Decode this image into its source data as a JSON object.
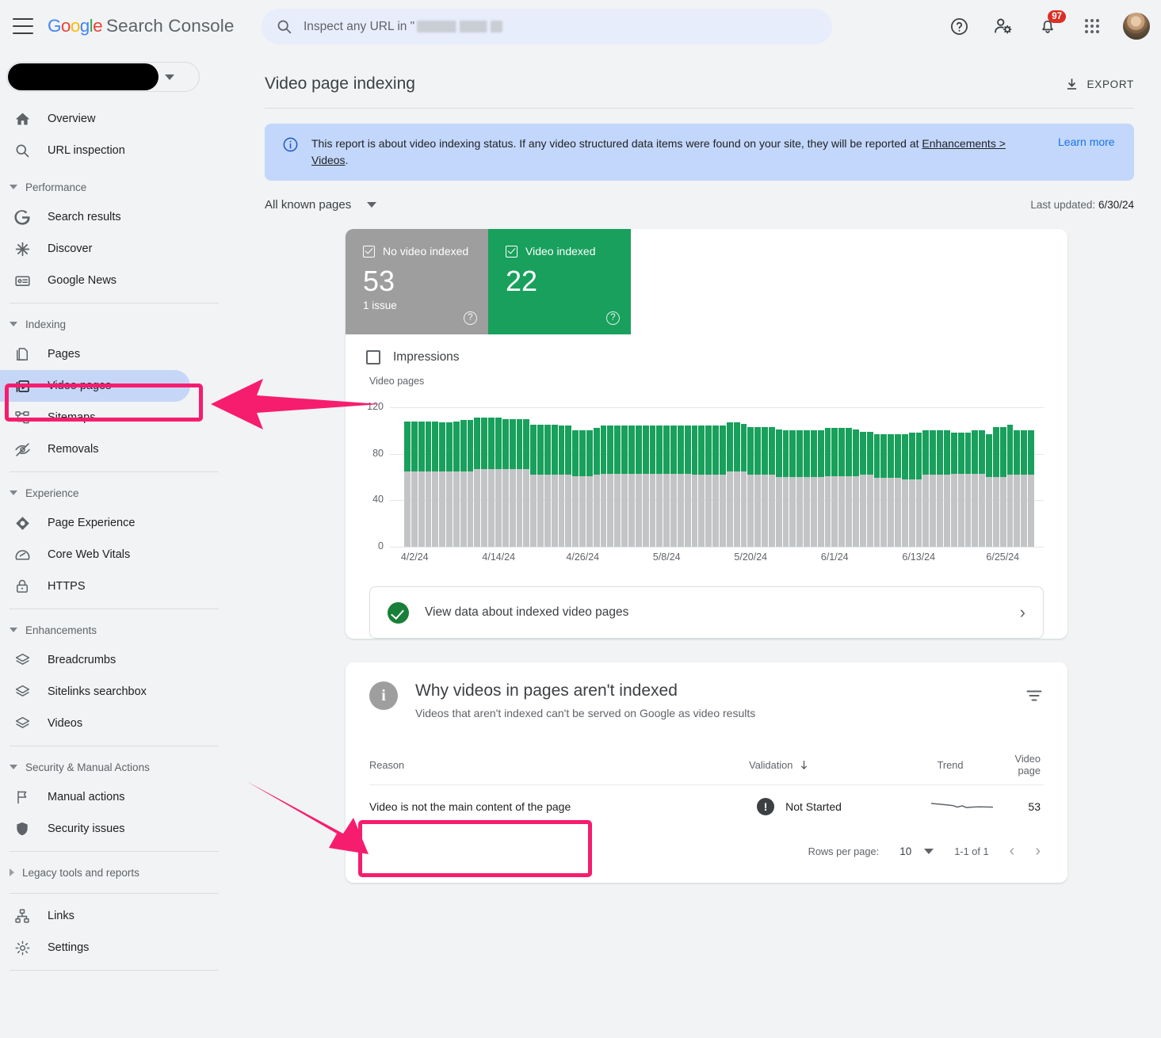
{
  "header": {
    "brand_google": "Google",
    "brand_suffix": "Search Console",
    "search_placeholder_prefix": "Inspect any URL in \"",
    "notification_count": "97",
    "icons": {
      "menu": "hamburger-icon",
      "search": "search-icon",
      "help": "help-icon",
      "users": "user-settings-icon",
      "notifications": "bell-icon",
      "apps": "apps-grid-icon",
      "avatar": "avatar"
    }
  },
  "sidebar": {
    "property_selector_label": "",
    "groups": [
      {
        "type": "items",
        "items": [
          {
            "label": "Overview",
            "icon": "home-icon"
          },
          {
            "label": "URL inspection",
            "icon": "search-icon"
          }
        ]
      },
      {
        "type": "section",
        "title": "Performance",
        "expanded": true,
        "items": [
          {
            "label": "Search results",
            "icon": "google-g-icon"
          },
          {
            "label": "Discover",
            "icon": "discover-icon"
          },
          {
            "label": "Google News",
            "icon": "news-icon"
          }
        ]
      },
      {
        "type": "section",
        "title": "Indexing",
        "expanded": true,
        "items": [
          {
            "label": "Pages",
            "icon": "pages-icon"
          },
          {
            "label": "Video pages",
            "icon": "video-pages-icon",
            "active": true
          },
          {
            "label": "Sitemaps",
            "icon": "sitemaps-icon"
          },
          {
            "label": "Removals",
            "icon": "removals-icon"
          }
        ]
      },
      {
        "type": "section",
        "title": "Experience",
        "expanded": true,
        "items": [
          {
            "label": "Page Experience",
            "icon": "page-experience-icon"
          },
          {
            "label": "Core Web Vitals",
            "icon": "core-web-vitals-icon"
          },
          {
            "label": "HTTPS",
            "icon": "lock-icon"
          }
        ]
      },
      {
        "type": "section",
        "title": "Enhancements",
        "expanded": true,
        "items": [
          {
            "label": "Breadcrumbs",
            "icon": "layers-icon"
          },
          {
            "label": "Sitelinks searchbox",
            "icon": "layers-icon"
          },
          {
            "label": "Videos",
            "icon": "layers-icon"
          }
        ]
      },
      {
        "type": "section",
        "title": "Security & Manual Actions",
        "expanded": true,
        "items": [
          {
            "label": "Manual actions",
            "icon": "flag-icon"
          },
          {
            "label": "Security issues",
            "icon": "shield-icon"
          }
        ]
      },
      {
        "type": "section",
        "title": "Legacy tools and reports",
        "expanded": false,
        "items": []
      },
      {
        "type": "items",
        "items": [
          {
            "label": "Links",
            "icon": "links-icon"
          },
          {
            "label": "Settings",
            "icon": "gear-icon"
          }
        ]
      }
    ]
  },
  "page": {
    "title": "Video page indexing",
    "export_label": "EXPORT",
    "notice": {
      "text_part1": "This report is about video indexing status. If any video structured data items were found on your site, they will be reported at ",
      "link_text": "Enhancements > Videos",
      "text_part2": ".",
      "learn_more": "Learn more"
    },
    "filter_label": "All known pages",
    "last_updated_label": "Last updated: ",
    "last_updated_value": "6/30/24"
  },
  "metrics": [
    {
      "name": "No video indexed",
      "value": "53",
      "sub": "1 issue",
      "color": "#9e9e9e",
      "help": "?"
    },
    {
      "name": "Video indexed",
      "value": "22",
      "sub": "",
      "color": "#18a05c",
      "help": "?"
    }
  ],
  "impressions_label": "Impressions",
  "view_data_row": {
    "label": "View data about indexed video pages"
  },
  "chart_data": {
    "type": "bar",
    "title": "",
    "ylabel": "Video pages",
    "xlabel": "",
    "ylim": [
      0,
      120
    ],
    "yticks": [
      0,
      40,
      80,
      120
    ],
    "grid": true,
    "stacked": true,
    "legend": [
      "No video indexed",
      "Video indexed"
    ],
    "legend_position": "top",
    "xtick_labels": [
      "4/2/24",
      "4/14/24",
      "4/26/24",
      "5/8/24",
      "5/20/24",
      "6/1/24",
      "6/13/24",
      "6/25/24"
    ],
    "xtick_indices": [
      1,
      13,
      25,
      37,
      49,
      61,
      73,
      85
    ],
    "series": [
      {
        "name": "No video indexed",
        "color": "#c3c4c6",
        "values": [
          65,
          65,
          65,
          65,
          65,
          65,
          65,
          65,
          65,
          65,
          67,
          67,
          67,
          67,
          67,
          67,
          67,
          67,
          62,
          62,
          62,
          62,
          62,
          62,
          61,
          61,
          61,
          62,
          63,
          63,
          63,
          63,
          63,
          63,
          63,
          63,
          63,
          63,
          63,
          63,
          63,
          62,
          62,
          62,
          62,
          62,
          65,
          65,
          65,
          62,
          62,
          62,
          62,
          60,
          60,
          60,
          60,
          60,
          60,
          60,
          61,
          61,
          61,
          61,
          61,
          62,
          62,
          59,
          59,
          59,
          59,
          58,
          58,
          58,
          62,
          62,
          62,
          62,
          63,
          63,
          63,
          63,
          63,
          60,
          60,
          60,
          62,
          62,
          62,
          62
        ]
      },
      {
        "name": "Video indexed",
        "color": "#18a05c",
        "values": [
          43,
          43,
          43,
          43,
          43,
          42,
          42,
          43,
          44,
          44,
          44,
          44,
          44,
          44,
          43,
          43,
          43,
          43,
          43,
          43,
          43,
          43,
          42,
          42,
          39,
          39,
          39,
          40,
          41,
          41,
          41,
          41,
          41,
          41,
          41,
          41,
          41,
          41,
          41,
          41,
          41,
          42,
          42,
          42,
          42,
          42,
          42,
          42,
          41,
          41,
          41,
          41,
          41,
          41,
          40,
          40,
          40,
          40,
          40,
          40,
          41,
          41,
          41,
          41,
          40,
          37,
          37,
          38,
          38,
          38,
          38,
          39,
          40,
          40,
          38,
          38,
          38,
          38,
          35,
          35,
          35,
          37,
          37,
          37,
          43,
          43,
          43,
          38,
          38,
          38
        ]
      }
    ]
  },
  "reasons_panel": {
    "title": "Why videos in pages aren't indexed",
    "subtitle": "Videos that aren't indexed can't be served on Google as video results",
    "columns": [
      "Reason",
      "Validation",
      "Trend",
      "Video page"
    ],
    "rows": [
      {
        "reason": "Video is not the main content of the page",
        "validation": "Not Started",
        "trend": "flat-declining",
        "video_page": "53"
      }
    ],
    "pagination": {
      "rows_per_page_label": "Rows per page:",
      "rows_per_page_value": "10",
      "range": "1-1 of 1",
      "prev": "‹",
      "next": "›"
    }
  },
  "annotations": {
    "arrow_color": "#f61d6e",
    "highlight_color": "#f61d6e",
    "arrow_targets": [
      "sidebar-item-video-pages",
      "reason-cell"
    ]
  }
}
